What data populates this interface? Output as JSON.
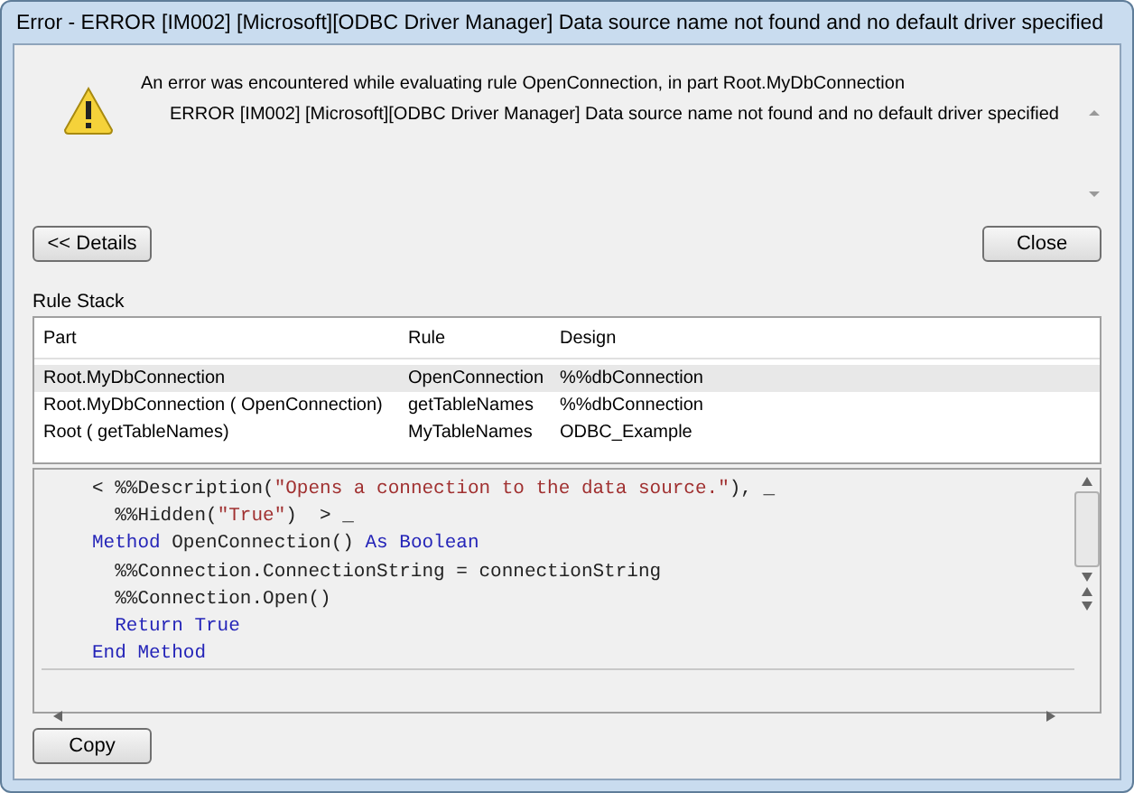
{
  "window": {
    "title": "Error - ERROR [IM002] [Microsoft][ODBC Driver Manager] Data source name not found and no default driver specified"
  },
  "message": {
    "summary": "An error was encountered while evaluating rule OpenConnection, in part Root.MyDbConnection",
    "detail": "ERROR [IM002] [Microsoft][ODBC Driver Manager] Data source name not found and no default driver specified"
  },
  "buttons": {
    "details": "<< Details",
    "close": "Close",
    "copy": "Copy"
  },
  "rule_stack": {
    "title": "Rule Stack",
    "columns": [
      "Part",
      "Rule",
      "Design"
    ],
    "rows": [
      {
        "cells": [
          "Root.MyDbConnection",
          "OpenConnection",
          "%%dbConnection"
        ],
        "selected": true
      },
      {
        "cells": [
          "Root.MyDbConnection ( OpenConnection)",
          "getTableNames",
          "%%dbConnection"
        ],
        "selected": false
      },
      {
        "cells": [
          "Root ( getTableNames)",
          "MyTableNames",
          "ODBC_Example"
        ],
        "selected": false
      }
    ]
  },
  "code": [
    [
      {
        "kind": "plain",
        "text": "< %%Description("
      },
      {
        "kind": "string",
        "text": "\"Opens a connection to the data source.\""
      },
      {
        "kind": "plain",
        "text": "), _"
      }
    ],
    [
      {
        "kind": "plain",
        "text": "  %%Hidden("
      },
      {
        "kind": "string",
        "text": "\"True\""
      },
      {
        "kind": "plain",
        "text": ")  > _"
      }
    ],
    [
      {
        "kind": "keyword",
        "text": "Method"
      },
      {
        "kind": "plain",
        "text": " OpenConnection() "
      },
      {
        "kind": "keyword",
        "text": "As Boolean"
      }
    ],
    [
      {
        "kind": "plain",
        "text": "  %%Connection.ConnectionString = connectionString"
      }
    ],
    [
      {
        "kind": "plain",
        "text": "  %%Connection.Open()"
      }
    ],
    [
      {
        "kind": "keyword",
        "text": "  Return True"
      }
    ],
    [
      {
        "kind": "keyword",
        "text": "End Method"
      }
    ]
  ]
}
